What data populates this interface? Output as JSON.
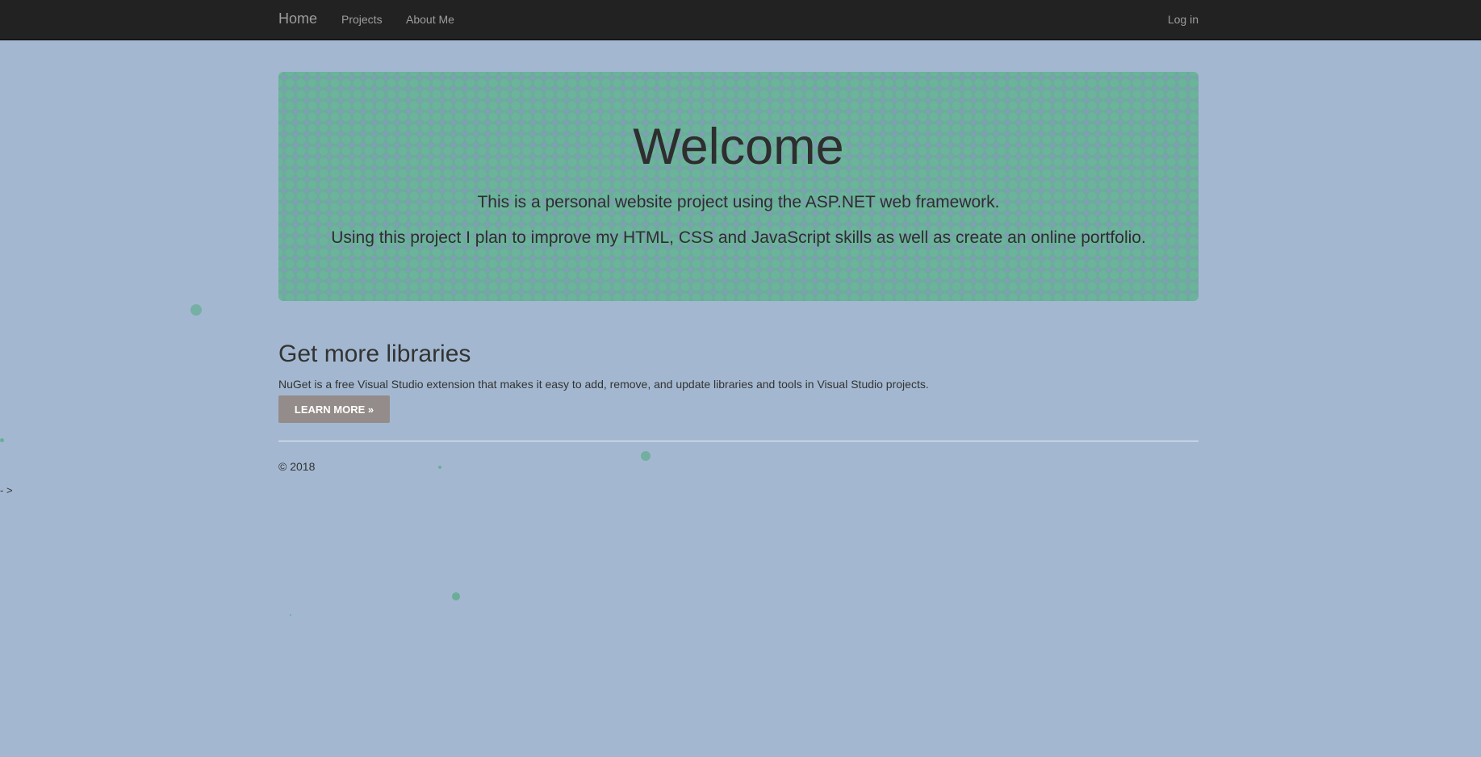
{
  "nav": {
    "brand": "Home",
    "links": [
      "Projects",
      "About Me"
    ],
    "login": "Log in"
  },
  "jumbotron": {
    "title": "Welcome",
    "lead1": "This is a personal website project using the ASP.NET web framework.",
    "lead2": "Using this project I plan to improve my HTML, CSS and JavaScript skills as well as create an online portfolio."
  },
  "section": {
    "title": "Get more libraries",
    "text": "NuGet is a free Visual Studio extension that makes it easy to add, remove, and update libraries and tools in Visual Studio projects.",
    "button": "Learn more »"
  },
  "footer": {
    "copyright": "© 2018"
  },
  "edge_text": "- >",
  "colors": {
    "background": "#a3b8d0",
    "navbar": "#222222",
    "jumbotron": "#6aad98",
    "button": "#948c8a",
    "particle": "#6aad98"
  }
}
